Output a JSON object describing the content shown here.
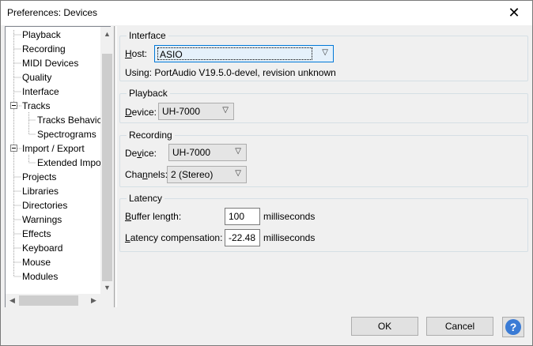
{
  "window": {
    "title": "Preferences: Devices",
    "close_icon": "close-icon"
  },
  "tree": {
    "items": [
      {
        "label": "Playback",
        "level": 1
      },
      {
        "label": "Recording",
        "level": 1
      },
      {
        "label": "MIDI Devices",
        "level": 1
      },
      {
        "label": "Quality",
        "level": 1
      },
      {
        "label": "Interface",
        "level": 1
      },
      {
        "label": "Tracks",
        "level": 1,
        "expander": "⊟"
      },
      {
        "label": "Tracks Behavic",
        "level": 2
      },
      {
        "label": "Spectrograms",
        "level": 2
      },
      {
        "label": "Import / Export",
        "level": 1,
        "expander": "⊟"
      },
      {
        "label": "Extended Impo",
        "level": 2
      },
      {
        "label": "Projects",
        "level": 1
      },
      {
        "label": "Libraries",
        "level": 1
      },
      {
        "label": "Directories",
        "level": 1
      },
      {
        "label": "Warnings",
        "level": 1
      },
      {
        "label": "Effects",
        "level": 1
      },
      {
        "label": "Keyboard",
        "level": 1
      },
      {
        "label": "Mouse",
        "level": 1
      },
      {
        "label": "Modules",
        "level": 1
      }
    ]
  },
  "interface_group": {
    "label": "Interface",
    "host_label_u": "H",
    "host_label_rest": "ost:",
    "host_value": "ASIO",
    "using_text": "Using: PortAudio V19.5.0-devel, revision unknown"
  },
  "playback_group": {
    "label": "Playback",
    "device_label_u": "D",
    "device_label_rest": "evice:",
    "device_value": "UH-7000"
  },
  "recording_group": {
    "label": "Recording",
    "device_label_pre": "De",
    "device_label_u": "v",
    "device_label_rest": "ice:",
    "device_value": "UH-7000",
    "channels_label_pre": "Cha",
    "channels_label_u": "n",
    "channels_label_rest": "nels:",
    "channels_value": "2 (Stereo)"
  },
  "latency_group": {
    "label": "Latency",
    "buffer_label_u": "B",
    "buffer_label_rest": "uffer length:",
    "buffer_value": "100",
    "buffer_unit": "milliseconds",
    "comp_label_u": "L",
    "comp_label_rest": "atency compensation:",
    "comp_value": "-22.48",
    "comp_unit": "milliseconds"
  },
  "buttons": {
    "ok": "OK",
    "cancel": "Cancel",
    "help": "?"
  }
}
